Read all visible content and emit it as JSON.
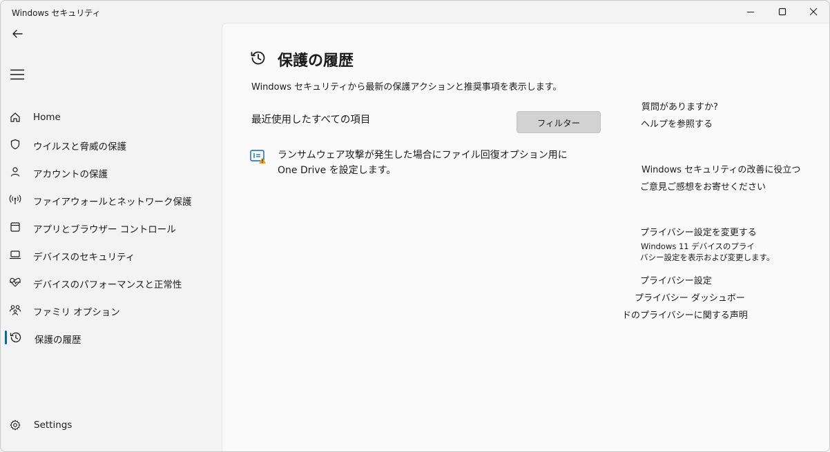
{
  "window": {
    "title": "Windows セキュリティ"
  },
  "nav": {
    "items": [
      {
        "label": "Home",
        "icon": "home-icon"
      },
      {
        "label": "ウイルスと脅威の保護",
        "icon": "shield-icon"
      },
      {
        "label": "アカウントの保護",
        "icon": "person-icon"
      },
      {
        "label": "ファイアウォールとネットワーク保護",
        "icon": "antenna-icon"
      },
      {
        "label": "アプリとブラウザー コントロール",
        "icon": "app-window-icon"
      },
      {
        "label": "デバイスのセキュリティ",
        "icon": "laptop-icon"
      },
      {
        "label": "デバイスのパフォーマンスと正常性",
        "icon": "heart-pulse-icon"
      },
      {
        "label": "ファミリ オプション",
        "icon": "family-icon"
      },
      {
        "label": "保護の履歴",
        "icon": "history-icon",
        "active": true
      }
    ],
    "settings_label": "Settings"
  },
  "main": {
    "title": "保護の履歴",
    "description": "Windows セキュリティから最新の保護アクションと推奨事項を表示します。",
    "section_title": "最近使用したすべての項目",
    "filter_label": "フィルター",
    "events": [
      {
        "text": "ランサムウェア攻撃が発生した場合にファイル回復オプション用に One Drive を設定します。",
        "icon": "onedrive-warning-icon"
      }
    ]
  },
  "right": {
    "question": "質問がありますか?",
    "help_link": "ヘルプを参照する",
    "improve_title": "Windows セキュリティの改善に役立つ",
    "feedback_link": "ご意見ご感想をお寄せください",
    "privacy_title": "プライバシー設定を変更する",
    "privacy_desc_line1": "Windows 11 デバイスのプライ",
    "privacy_desc_line2": "バシー設定を表示および変更します。",
    "privacy_settings_link": "プライバシー設定",
    "privacy_dashboard_link": "プライバシー ダッシュボー",
    "privacy_statement_link": "ドのプライバシーに関する声明"
  },
  "colors": {
    "accent": "#0067c0",
    "background": "#f3f3f3",
    "content_background": "#fafafa",
    "button": "#d2d2d2",
    "warning": "#f0a30a"
  }
}
